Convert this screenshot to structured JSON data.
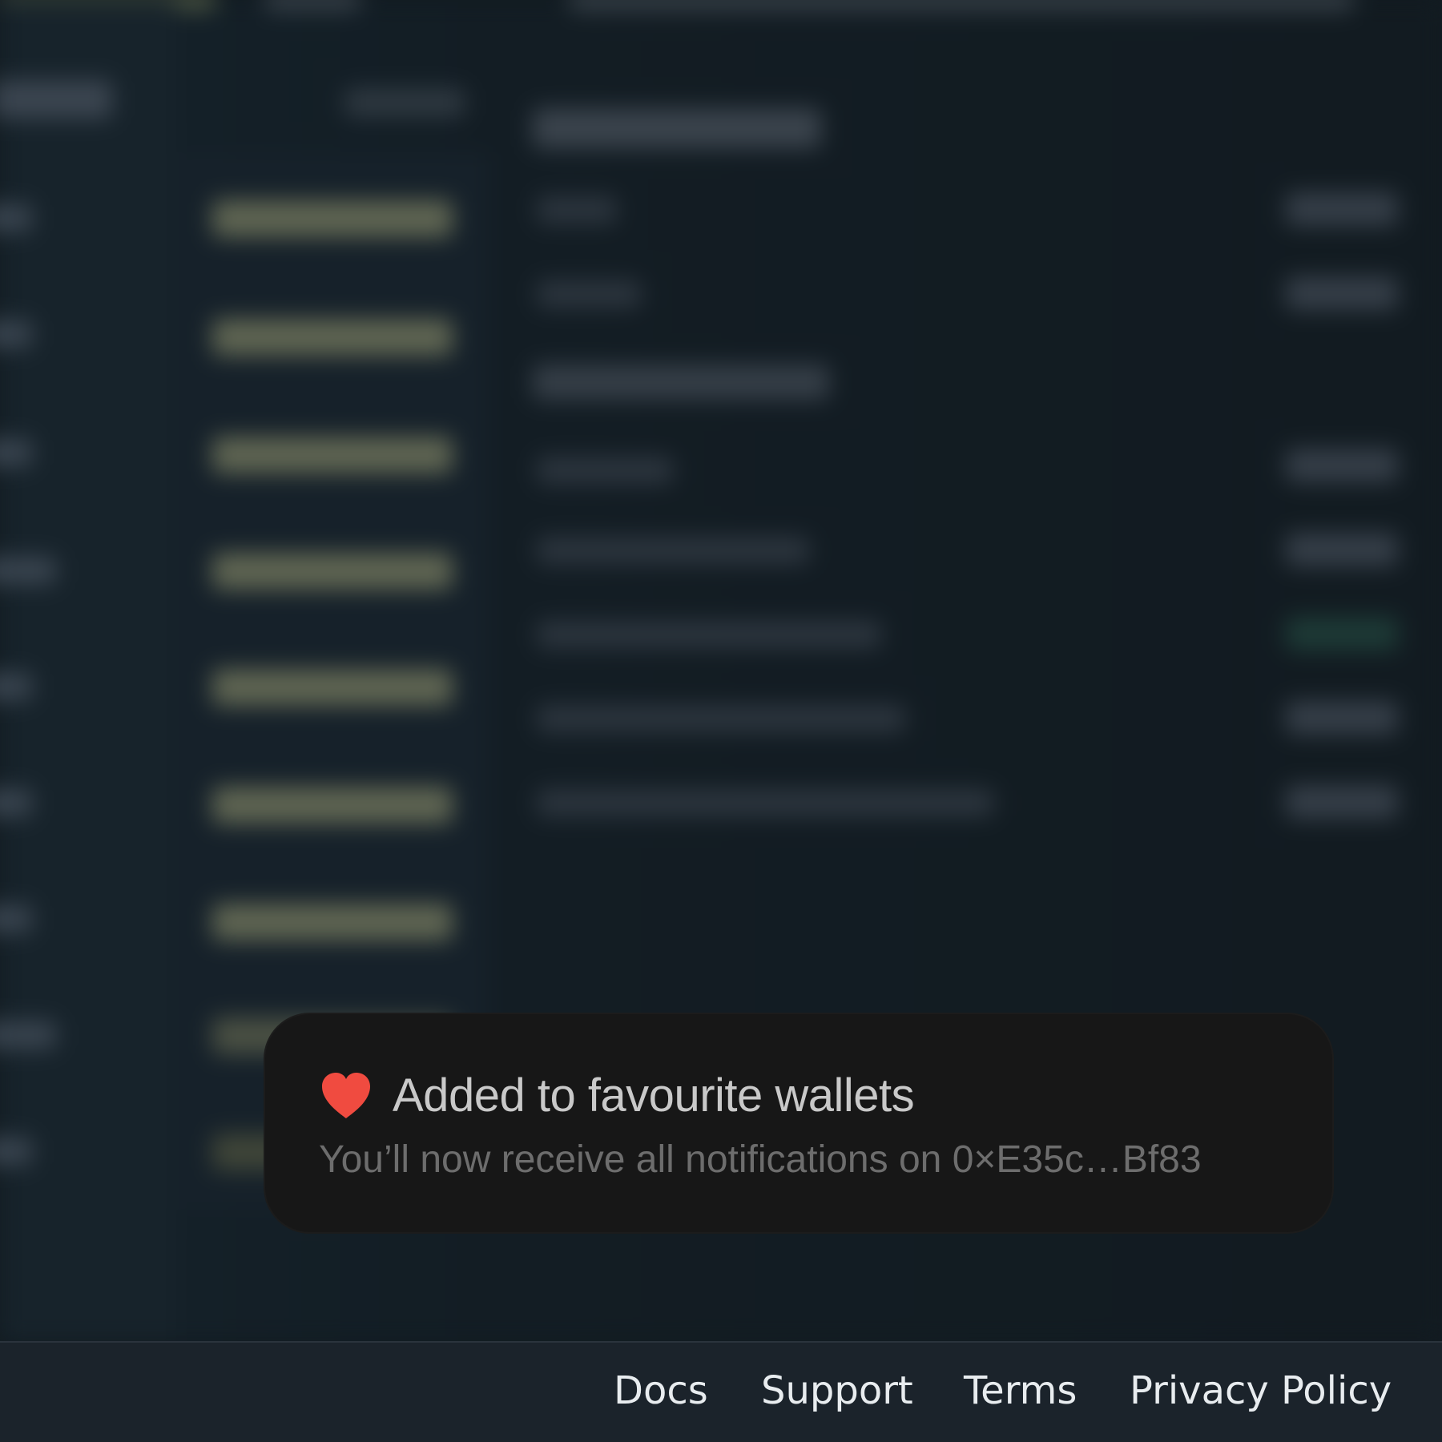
{
  "toast": {
    "icon": "heart-icon",
    "icon_color": "#f04b40",
    "title": "Added to favourite wallets",
    "message": "You’ll now receive all notifications on 0×E35c…Bf83"
  },
  "footer": {
    "links": [
      "Docs",
      "Support",
      "Terms",
      "Privacy Policy"
    ]
  },
  "colors": {
    "background": "#121b21",
    "toast_background": "#171717",
    "footer_background": "#1b232b"
  }
}
